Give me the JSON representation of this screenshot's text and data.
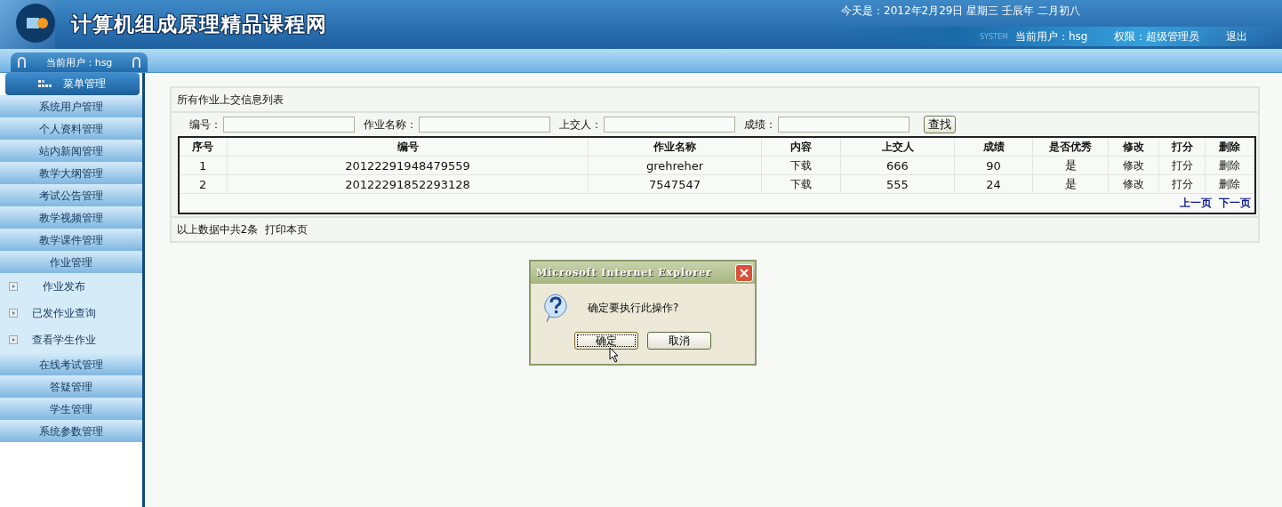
{
  "header": {
    "title": "计算机组成原理精品课程网",
    "date": "今天是：2012年2月29日 星期三 壬辰年 二月初八",
    "system_mark": "SYSTEM",
    "current_user": "当前用户：hsg",
    "role": "权限：超级管理员",
    "logout": "退出"
  },
  "sidebar": {
    "user_tab": "当前用户：hsg",
    "menu_title": "菜单管理",
    "items": [
      {
        "kind": "section",
        "label": "系统用户管理"
      },
      {
        "kind": "section",
        "label": "个人资料管理"
      },
      {
        "kind": "section",
        "label": "站内新闻管理"
      },
      {
        "kind": "section",
        "label": "教学大纲管理"
      },
      {
        "kind": "section",
        "label": "考试公告管理"
      },
      {
        "kind": "section",
        "label": "教学视频管理"
      },
      {
        "kind": "section",
        "label": "教学课件管理"
      },
      {
        "kind": "section",
        "label": "作业管理"
      },
      {
        "kind": "sub",
        "label": "作业发布"
      },
      {
        "kind": "sub",
        "label": "已发作业查询"
      },
      {
        "kind": "sub",
        "label": "查看学生作业"
      },
      {
        "kind": "section",
        "label": "在线考试管理"
      },
      {
        "kind": "section",
        "label": "答疑管理"
      },
      {
        "kind": "section",
        "label": "学生管理"
      },
      {
        "kind": "section",
        "label": "系统参数管理"
      }
    ]
  },
  "panel": {
    "title": "所有作业上交信息列表",
    "filters": [
      {
        "label": "编号："
      },
      {
        "label": "作业名称："
      },
      {
        "label": "上交人："
      },
      {
        "label": "成绩："
      }
    ],
    "search_button": "查找",
    "table": {
      "columns": [
        "序号",
        "编号",
        "作业名称",
        "内容",
        "上交人",
        "成绩",
        "是否优秀",
        "修改",
        "打分",
        "删除"
      ],
      "rows": [
        [
          "1",
          "20122291948479559",
          "grehreher",
          "下载",
          "666",
          "90",
          "是",
          "修改",
          "打分",
          "删除"
        ],
        [
          "2",
          "20122291852293128",
          "7547547",
          "下载",
          "555",
          "24",
          "是",
          "修改",
          "打分",
          "删除"
        ]
      ]
    },
    "pager": [
      "上一页",
      "下一页"
    ],
    "summary": "以上数据中共2条",
    "print_link": "打印本页"
  },
  "dialog": {
    "title": "Microsoft Internet Explorer",
    "message": "确定要执行此操作?",
    "buttons": [
      {
        "label": "确定",
        "selected": true
      },
      {
        "label": "取消",
        "selected": false
      }
    ]
  }
}
